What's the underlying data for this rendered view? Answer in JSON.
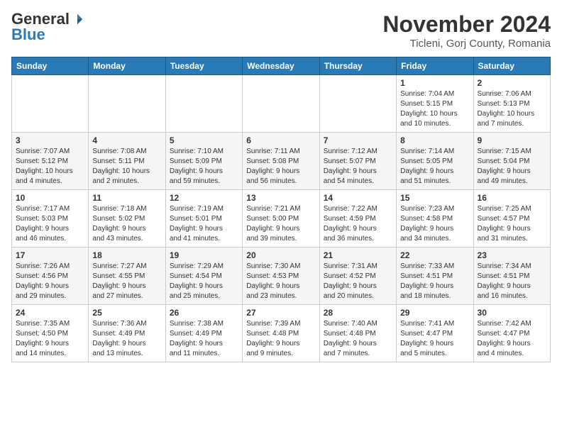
{
  "header": {
    "logo_general": "General",
    "logo_blue": "Blue",
    "month_year": "November 2024",
    "location": "Ticleni, Gorj County, Romania"
  },
  "weekdays": [
    "Sunday",
    "Monday",
    "Tuesday",
    "Wednesday",
    "Thursday",
    "Friday",
    "Saturday"
  ],
  "weeks": [
    [
      {
        "day": "",
        "info": ""
      },
      {
        "day": "",
        "info": ""
      },
      {
        "day": "",
        "info": ""
      },
      {
        "day": "",
        "info": ""
      },
      {
        "day": "",
        "info": ""
      },
      {
        "day": "1",
        "info": "Sunrise: 7:04 AM\nSunset: 5:15 PM\nDaylight: 10 hours\nand 10 minutes."
      },
      {
        "day": "2",
        "info": "Sunrise: 7:06 AM\nSunset: 5:13 PM\nDaylight: 10 hours\nand 7 minutes."
      }
    ],
    [
      {
        "day": "3",
        "info": "Sunrise: 7:07 AM\nSunset: 5:12 PM\nDaylight: 10 hours\nand 4 minutes."
      },
      {
        "day": "4",
        "info": "Sunrise: 7:08 AM\nSunset: 5:11 PM\nDaylight: 10 hours\nand 2 minutes."
      },
      {
        "day": "5",
        "info": "Sunrise: 7:10 AM\nSunset: 5:09 PM\nDaylight: 9 hours\nand 59 minutes."
      },
      {
        "day": "6",
        "info": "Sunrise: 7:11 AM\nSunset: 5:08 PM\nDaylight: 9 hours\nand 56 minutes."
      },
      {
        "day": "7",
        "info": "Sunrise: 7:12 AM\nSunset: 5:07 PM\nDaylight: 9 hours\nand 54 minutes."
      },
      {
        "day": "8",
        "info": "Sunrise: 7:14 AM\nSunset: 5:05 PM\nDaylight: 9 hours\nand 51 minutes."
      },
      {
        "day": "9",
        "info": "Sunrise: 7:15 AM\nSunset: 5:04 PM\nDaylight: 9 hours\nand 49 minutes."
      }
    ],
    [
      {
        "day": "10",
        "info": "Sunrise: 7:17 AM\nSunset: 5:03 PM\nDaylight: 9 hours\nand 46 minutes."
      },
      {
        "day": "11",
        "info": "Sunrise: 7:18 AM\nSunset: 5:02 PM\nDaylight: 9 hours\nand 43 minutes."
      },
      {
        "day": "12",
        "info": "Sunrise: 7:19 AM\nSunset: 5:01 PM\nDaylight: 9 hours\nand 41 minutes."
      },
      {
        "day": "13",
        "info": "Sunrise: 7:21 AM\nSunset: 5:00 PM\nDaylight: 9 hours\nand 39 minutes."
      },
      {
        "day": "14",
        "info": "Sunrise: 7:22 AM\nSunset: 4:59 PM\nDaylight: 9 hours\nand 36 minutes."
      },
      {
        "day": "15",
        "info": "Sunrise: 7:23 AM\nSunset: 4:58 PM\nDaylight: 9 hours\nand 34 minutes."
      },
      {
        "day": "16",
        "info": "Sunrise: 7:25 AM\nSunset: 4:57 PM\nDaylight: 9 hours\nand 31 minutes."
      }
    ],
    [
      {
        "day": "17",
        "info": "Sunrise: 7:26 AM\nSunset: 4:56 PM\nDaylight: 9 hours\nand 29 minutes."
      },
      {
        "day": "18",
        "info": "Sunrise: 7:27 AM\nSunset: 4:55 PM\nDaylight: 9 hours\nand 27 minutes."
      },
      {
        "day": "19",
        "info": "Sunrise: 7:29 AM\nSunset: 4:54 PM\nDaylight: 9 hours\nand 25 minutes."
      },
      {
        "day": "20",
        "info": "Sunrise: 7:30 AM\nSunset: 4:53 PM\nDaylight: 9 hours\nand 23 minutes."
      },
      {
        "day": "21",
        "info": "Sunrise: 7:31 AM\nSunset: 4:52 PM\nDaylight: 9 hours\nand 20 minutes."
      },
      {
        "day": "22",
        "info": "Sunrise: 7:33 AM\nSunset: 4:51 PM\nDaylight: 9 hours\nand 18 minutes."
      },
      {
        "day": "23",
        "info": "Sunrise: 7:34 AM\nSunset: 4:51 PM\nDaylight: 9 hours\nand 16 minutes."
      }
    ],
    [
      {
        "day": "24",
        "info": "Sunrise: 7:35 AM\nSunset: 4:50 PM\nDaylight: 9 hours\nand 14 minutes."
      },
      {
        "day": "25",
        "info": "Sunrise: 7:36 AM\nSunset: 4:49 PM\nDaylight: 9 hours\nand 13 minutes."
      },
      {
        "day": "26",
        "info": "Sunrise: 7:38 AM\nSunset: 4:49 PM\nDaylight: 9 hours\nand 11 minutes."
      },
      {
        "day": "27",
        "info": "Sunrise: 7:39 AM\nSunset: 4:48 PM\nDaylight: 9 hours\nand 9 minutes."
      },
      {
        "day": "28",
        "info": "Sunrise: 7:40 AM\nSunset: 4:48 PM\nDaylight: 9 hours\nand 7 minutes."
      },
      {
        "day": "29",
        "info": "Sunrise: 7:41 AM\nSunset: 4:47 PM\nDaylight: 9 hours\nand 5 minutes."
      },
      {
        "day": "30",
        "info": "Sunrise: 7:42 AM\nSunset: 4:47 PM\nDaylight: 9 hours\nand 4 minutes."
      }
    ]
  ]
}
